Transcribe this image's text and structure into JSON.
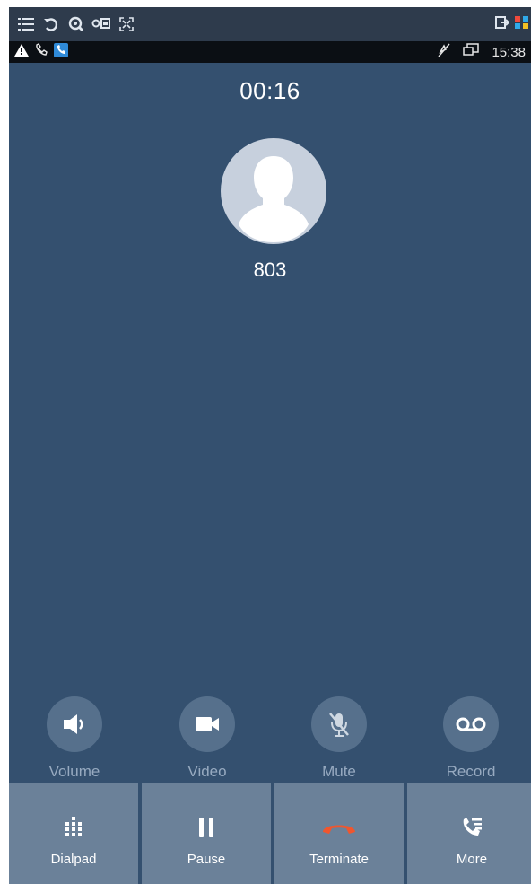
{
  "toolbar": {
    "icons": [
      "list-icon",
      "undo-icon",
      "zoom-icon",
      "settings-icon",
      "fullscreen-icon",
      "exit-icon",
      "grid-icon"
    ]
  },
  "statusbar": {
    "icons": [
      "warning-icon",
      "missed-call-icon",
      "call-app-icon",
      "mute-ring-icon",
      "screens-icon"
    ],
    "time": "15:38"
  },
  "call": {
    "duration": "00:16",
    "contact": "803"
  },
  "actions": [
    {
      "label": "Volume",
      "icon": "volume-icon"
    },
    {
      "label": "Video",
      "icon": "video-icon"
    },
    {
      "label": "Mute",
      "icon": "mute-icon"
    },
    {
      "label": "Record",
      "icon": "record-icon"
    }
  ],
  "bottom_buttons": [
    {
      "label": "Dialpad",
      "icon": "dialpad-icon"
    },
    {
      "label": "Pause",
      "icon": "pause-icon"
    },
    {
      "label": "Terminate",
      "icon": "end-call-icon"
    },
    {
      "label": "More",
      "icon": "more-icon"
    }
  ],
  "colors": {
    "background": "#34506f",
    "action_circle": "#56708c",
    "bottom_button": "#6b8199",
    "terminate": "#f0562e"
  }
}
